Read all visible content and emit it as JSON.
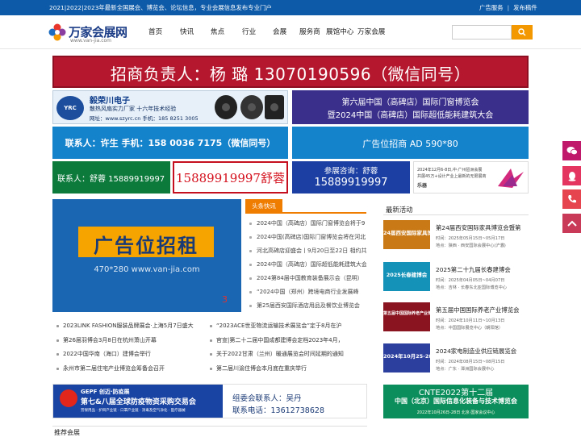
{
  "topbar": {
    "notice": "2021|2022|2023年最新全国展会、博览会、论坛信息，专业会展信息发布专业门户",
    "link_ad": "广告服务",
    "link_sep": "|",
    "link_post": "发布稿件"
  },
  "logo": {
    "title": "万家会展网",
    "url": "www.van-jia.com"
  },
  "nav": [
    "首页",
    "快讯",
    "焦点",
    "行业",
    "会展",
    "服务商",
    "展馆中心",
    "万家会展"
  ],
  "search": {
    "placeholder": ""
  },
  "banners": {
    "b1": "招商负责人：杨 璐 13070190596（微信同号）",
    "b2_logo": "YRC",
    "b2_brand": "毅荣川电子",
    "b2_sub": "散热风扇实力厂家  十六年技术经验",
    "b2_web": "网址：www.szyrc.cn 手机：185 8251 3005",
    "b3_l1": "第六届中国（高碑店）国际门窗博览会",
    "b3_l2": "暨2024中国（高碑店）国际超低能耗建筑大会",
    "b4": "联系人：许生  手机：158 0036 7175（微信同号）",
    "b5": "广告位招商 AD 590*80",
    "b6": "联系人：舒蓉 15889919997",
    "b7": "15889919997舒蓉",
    "b8_l1": "参展咨询：舒蓉",
    "b8_l2": "15889919997",
    "b9_l1": "2024年12月6-8日,中·广州琶洲会展",
    "b9_l2": "共展45万+设计产业上最新的无限展商",
    "b9_l3": "乐器"
  },
  "bigad": {
    "title": "广告位招租",
    "dim": "470*280 www.van-jia.com",
    "index": "3"
  },
  "headlines": {
    "tab": "头条快讯",
    "items": [
      "2024中国（高碑店）国际门窗博览会将于9",
      "2024中国(高碑店)国际门窗博览会将在河北",
      "河北高碑店迎盛会丨9月20日至22日 相约共",
      "2024中国（高碑店）国际超低能耗建筑大会",
      "2024第84届中国教育装备展示会（昆明）",
      "“2024中国（郑州）跨境电商行业发展峰",
      "第25届西安国际酒店用品及餐饮业博览会"
    ]
  },
  "news_left": [
    "2023LINK FASHION服装品牌展会·上海5月7日盛大",
    "第26届羽博会3月8日在杭州萧山开幕",
    "2022中国华南（海口）建博会举行",
    "永州市第二届住宅产业博览会筹备会召开"
  ],
  "news_right": [
    "“2023ACE世亚物流运输技术展览会”定于8月在沪",
    "官宣|第二十二届中国成都建博会定档2023年4月，",
    "关于2022甘肃（兰州）暖通展览会时间延期的通知",
    "第二届川渝住博会本月底在重庆举行"
  ],
  "recent": {
    "title": "最新活动",
    "items": [
      {
        "thumb": "24届西安国际家具博览会",
        "name": "第24届西安国际家具博览会暨第",
        "time": "时间：2025年05月15日~05月17日",
        "place": "地点：陕西 · 西安国际会展中心(浐灞)",
        "color": "#c97a17"
      },
      {
        "thumb": "2025长春建博会",
        "name": "2025第二十九届长春建博会",
        "time": "时间：2025年04月05日~04月07日",
        "place": "地点：吉林 · 长春东北亚国际博览中心",
        "color": "#1492b8"
      },
      {
        "thumb": "第五届中国国际养老产业博览会",
        "name": "第五届中国国际养老产业博览会",
        "time": "时间：2024年10月11日~10月13日",
        "place": "地点：中国国际展览中心（朝阳馆）",
        "color": "#8a1420"
      },
      {
        "thumb": "2024年10月25-28日",
        "name": "2024家电制造业供应链展览会",
        "time": "时间：2024年08月15日~08月15日",
        "place": "地点：广东 · 潭洲国际会展中心",
        "color": "#2d3f9e"
      }
    ]
  },
  "gepf": {
    "l1": "GEPF 创迈·防疫展",
    "l2": "第七&八届全球防疫物资采购交易会",
    "l3": "劳保用品 · 护目产业链 · 口罩产业链 · 消毒及空气净化 · 医疗器械",
    "contact": "组委会联系人：吴丹",
    "phone": "联系电话：13612738628"
  },
  "cnte": {
    "l1": "CNTE2022第十二届",
    "l2": "中国（北京）国际信息化装备与技术博览会",
    "l3": "2022年10月26日-28日  北京·国家会议中心"
  },
  "bottom": {
    "title": "推荐会展"
  },
  "colors": {
    "brand": "#0d5aa8",
    "accent": "#ef7d00",
    "search_btn": "#f39800",
    "red": "#b5182e",
    "wechat": "#c0186b",
    "qq": "#e33560",
    "phone": "#e6454f",
    "top": "#c93a58"
  }
}
